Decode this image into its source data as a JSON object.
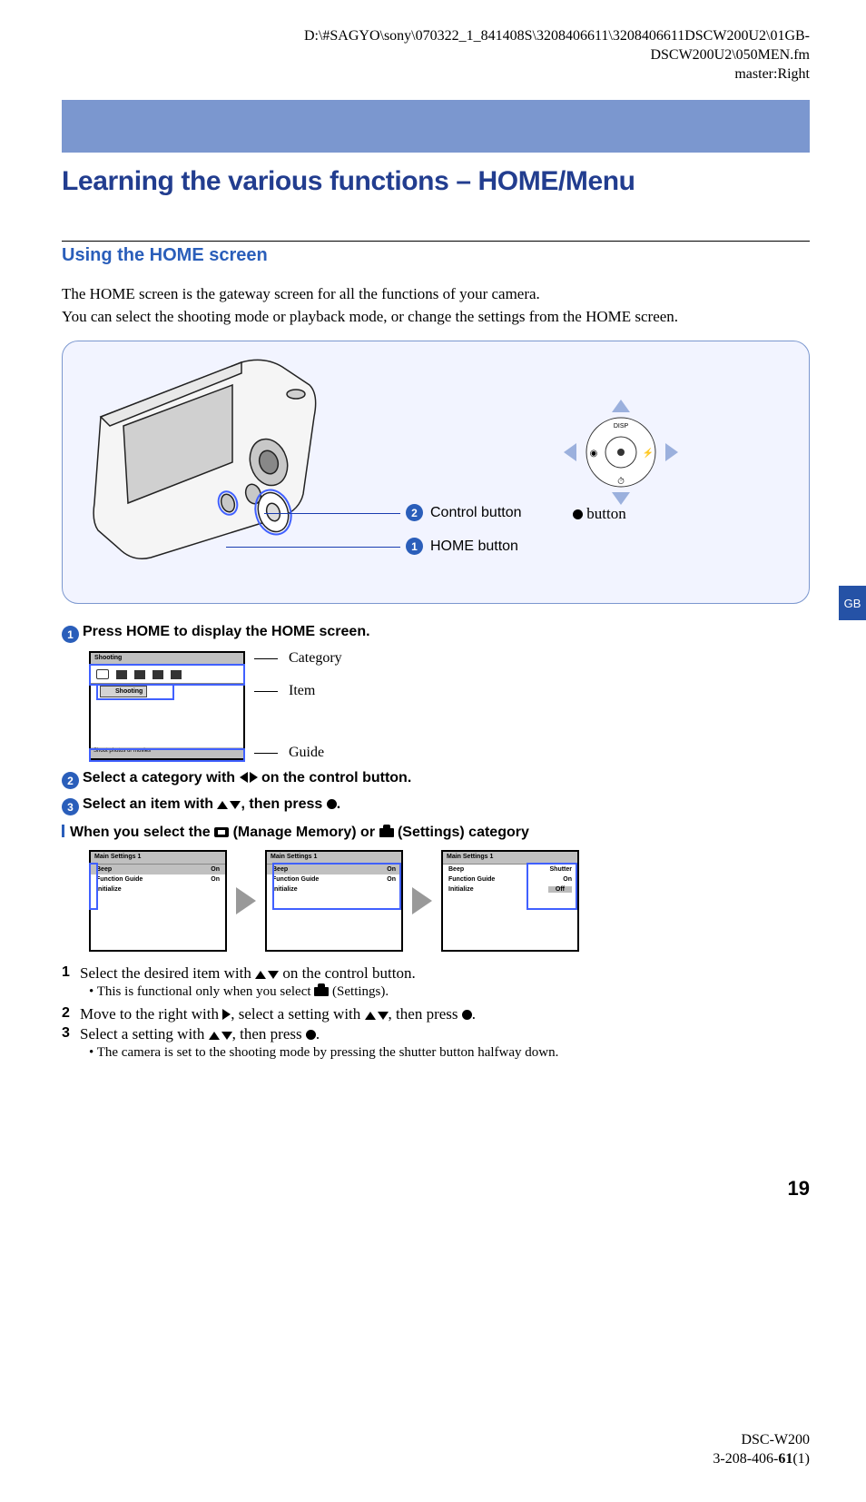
{
  "header": {
    "path1": "D:\\#SAGYO\\sony\\070322_1_841408S\\3208406611\\3208406611DSCW200U2\\01GB-",
    "path2": "DSCW200U2\\050MEN.fm",
    "path3": "master:Right"
  },
  "title": "Learning the various functions – HOME/Menu",
  "section_title": "Using the HOME screen",
  "intro1": "The HOME screen is the gateway screen for all the functions of your camera.",
  "intro2": "You can select the shooting mode or playback mode, or change the settings from the HOME screen.",
  "fig": {
    "callout1": "Control button",
    "callout2": "HOME button",
    "button_label": "button",
    "disp": "DISP"
  },
  "tab": "GB",
  "step1": "Press HOME to display the HOME screen.",
  "screen1": {
    "header": "Shooting",
    "item": "Shooting",
    "footer": "Shoot photos or movies",
    "anno_cat": "Category",
    "anno_item": "Item",
    "anno_guide": "Guide"
  },
  "step2_pre": "Select a category with ",
  "step2_post": " on the control button.",
  "step3_pre": "Select an item with ",
  "step3_mid": ", then press ",
  "step3_post": ".",
  "sub_h_pre": "When you select the ",
  "sub_h_mm": " (Manage Memory) or ",
  "sub_h_st": " (Settings) category",
  "settings_shots": {
    "h": "Main Settings 1",
    "r1a": "Beep",
    "r1b": "On",
    "r2a": "Function Guide",
    "r2b": "On",
    "r3a": "Initialize",
    "s3_r1a": "Beep",
    "s3_r1b": "Shutter",
    "s3_r2b": "On",
    "s3_r3b": "Off"
  },
  "num1_pre": "Select the desired item with ",
  "num1_post": " on the control button.",
  "bullet1_pre": "• This is functional only when you select ",
  "bullet1_post": " (Settings).",
  "num2_pre": "Move to the right with ",
  "num2_mid1": ", select a setting with ",
  "num2_mid2": ", then press ",
  "num2_post": ".",
  "num3_pre": "Select a setting with ",
  "num3_mid": ", then press ",
  "num3_post": ".",
  "bullet2": "• The camera is set to the shooting mode by pressing the shutter button halfway down.",
  "page_num": "19",
  "footer1": "DSC-W200",
  "footer2_pre": "3-208-406-",
  "footer2_bold": "61",
  "footer2_post": "(1)"
}
